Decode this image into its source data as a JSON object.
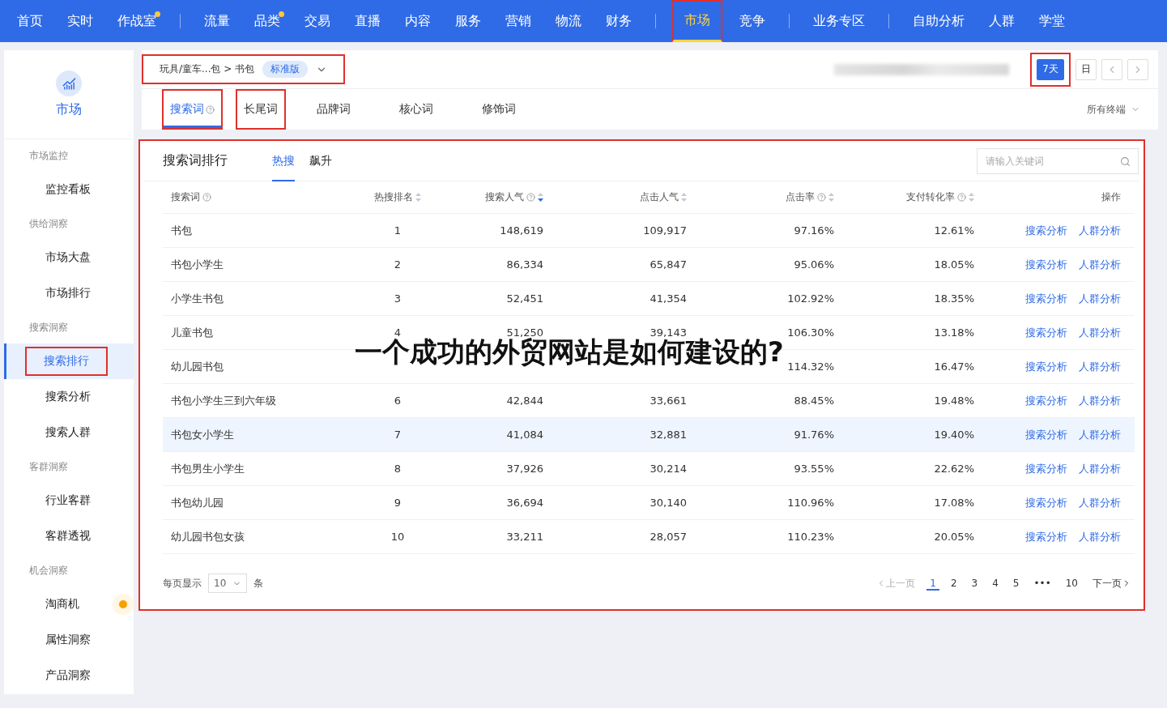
{
  "nav": {
    "groups": [
      [
        {
          "label": "首页",
          "dot": false,
          "selected": false,
          "annotated": false
        },
        {
          "label": "实时",
          "dot": false,
          "selected": false,
          "annotated": false
        },
        {
          "label": "作战室",
          "dot": true,
          "selected": false,
          "annotated": false
        }
      ],
      [
        {
          "label": "流量",
          "dot": false,
          "selected": false,
          "annotated": false
        },
        {
          "label": "品类",
          "dot": true,
          "selected": false,
          "annotated": false
        },
        {
          "label": "交易",
          "dot": false,
          "selected": false,
          "annotated": false
        },
        {
          "label": "直播",
          "dot": false,
          "selected": false,
          "annotated": false
        },
        {
          "label": "内容",
          "dot": false,
          "selected": false,
          "annotated": false
        },
        {
          "label": "服务",
          "dot": false,
          "selected": false,
          "annotated": false
        },
        {
          "label": "营销",
          "dot": false,
          "selected": false,
          "annotated": false
        },
        {
          "label": "物流",
          "dot": false,
          "selected": false,
          "annotated": false
        },
        {
          "label": "财务",
          "dot": false,
          "selected": false,
          "annotated": false
        }
      ],
      [
        {
          "label": "市场",
          "dot": false,
          "selected": true,
          "annotated": true
        },
        {
          "label": "竞争",
          "dot": false,
          "selected": false,
          "annotated": false
        }
      ],
      [
        {
          "label": "业务专区",
          "dot": false,
          "selected": false,
          "annotated": false
        }
      ],
      [
        {
          "label": "自助分析",
          "dot": false,
          "selected": false,
          "annotated": false
        },
        {
          "label": "人群",
          "dot": false,
          "selected": false,
          "annotated": false
        },
        {
          "label": "学堂",
          "dot": false,
          "selected": false,
          "annotated": false
        }
      ]
    ]
  },
  "sidebar": {
    "title": "市场",
    "sections": [
      {
        "heading": "市场监控",
        "items": [
          {
            "label": "监控看板",
            "selected": false,
            "annotated": false,
            "dot": false
          }
        ]
      },
      {
        "heading": "供给洞察",
        "items": [
          {
            "label": "市场大盘",
            "selected": false,
            "annotated": false,
            "dot": false
          },
          {
            "label": "市场排行",
            "selected": false,
            "annotated": false,
            "dot": false
          }
        ]
      },
      {
        "heading": "搜索洞察",
        "items": [
          {
            "label": "搜索排行",
            "selected": true,
            "annotated": true,
            "dot": false
          },
          {
            "label": "搜索分析",
            "selected": false,
            "annotated": false,
            "dot": false
          },
          {
            "label": "搜索人群",
            "selected": false,
            "annotated": false,
            "dot": false
          }
        ]
      },
      {
        "heading": "客群洞察",
        "items": [
          {
            "label": "行业客群",
            "selected": false,
            "annotated": false,
            "dot": false
          },
          {
            "label": "客群透视",
            "selected": false,
            "annotated": false,
            "dot": false
          }
        ]
      },
      {
        "heading": "机会洞察",
        "items": [
          {
            "label": "淘商机",
            "selected": false,
            "annotated": false,
            "dot": true
          },
          {
            "label": "属性洞察",
            "selected": false,
            "annotated": false,
            "dot": false
          },
          {
            "label": "产品洞察",
            "selected": false,
            "annotated": false,
            "dot": false
          }
        ]
      }
    ]
  },
  "filter": {
    "breadcrumb": "玩具/童车...包 > 书包",
    "badge": "标准版",
    "annotated": true,
    "periods": [
      {
        "label": "7天",
        "selected": true,
        "annotated": true
      },
      {
        "label": "日",
        "selected": false,
        "annotated": false
      }
    ],
    "tabs": [
      {
        "label": "搜索词",
        "help": true,
        "selected": true,
        "annotated": true
      },
      {
        "label": "长尾词",
        "help": false,
        "selected": false,
        "annotated": true
      },
      {
        "label": "品牌词",
        "help": false,
        "selected": false,
        "annotated": false
      },
      {
        "label": "核心词",
        "help": false,
        "selected": false,
        "annotated": false
      },
      {
        "label": "修饰词",
        "help": false,
        "selected": false,
        "annotated": false
      }
    ],
    "terminal": "所有终端"
  },
  "ranking": {
    "title": "搜索词排行",
    "annotated": true,
    "tabs": [
      {
        "label": "热搜",
        "selected": true
      },
      {
        "label": "飙升",
        "selected": false
      }
    ],
    "search": {
      "placeholder": "请输入关键词"
    },
    "columns": [
      {
        "label": "搜索词",
        "help": true,
        "sortable": false
      },
      {
        "label": "热搜排名",
        "help": false,
        "sortable": true,
        "sorted": false
      },
      {
        "label": "搜索人气",
        "help": true,
        "sortable": true,
        "sorted": true
      },
      {
        "label": "点击人气",
        "help": false,
        "sortable": true,
        "sorted": false
      },
      {
        "label": "点击率",
        "help": true,
        "sortable": true,
        "sorted": false
      },
      {
        "label": "支付转化率",
        "help": true,
        "sortable": true,
        "sorted": false
      },
      {
        "label": "操作",
        "help": false,
        "sortable": false
      }
    ],
    "rows": [
      {
        "keyword": "书包",
        "rank": "1",
        "search": "148,619",
        "clicks": "109,917",
        "click_rate": "97.16%",
        "conversion": "12.61%",
        "actions": [
          "搜索分析",
          "人群分析"
        ],
        "highlighted": false
      },
      {
        "keyword": "书包小学生",
        "rank": "2",
        "search": "86,334",
        "clicks": "65,847",
        "click_rate": "95.06%",
        "conversion": "18.05%",
        "actions": [
          "搜索分析",
          "人群分析"
        ],
        "highlighted": false
      },
      {
        "keyword": "小学生书包",
        "rank": "3",
        "search": "52,451",
        "clicks": "41,354",
        "click_rate": "102.92%",
        "conversion": "18.35%",
        "actions": [
          "搜索分析",
          "人群分析"
        ],
        "highlighted": false
      },
      {
        "keyword": "儿童书包",
        "rank": "4",
        "search": "51,250",
        "clicks": "39,143",
        "click_rate": "106.30%",
        "conversion": "13.18%",
        "actions": [
          "搜索分析",
          "人群分析"
        ],
        "highlighted": false
      },
      {
        "keyword": "幼儿园书包",
        "click_rate": "114.32%",
        "conversion": "16.47%",
        "actions": [
          "搜索分析",
          "人群分析"
        ],
        "highlighted": false
      },
      {
        "keyword": "书包小学生三到六年级",
        "rank": "6",
        "search": "42,844",
        "clicks": "33,661",
        "click_rate": "88.45%",
        "conversion": "19.48%",
        "actions": [
          "搜索分析",
          "人群分析"
        ],
        "highlighted": false
      },
      {
        "keyword": "书包女小学生",
        "rank": "7",
        "search": "41,084",
        "clicks": "32,881",
        "click_rate": "91.76%",
        "conversion": "19.40%",
        "actions": [
          "搜索分析",
          "人群分析"
        ],
        "highlighted": true
      },
      {
        "keyword": "书包男生小学生",
        "rank": "8",
        "search": "37,926",
        "clicks": "30,214",
        "click_rate": "93.55%",
        "conversion": "22.62%",
        "actions": [
          "搜索分析",
          "人群分析"
        ],
        "highlighted": false
      },
      {
        "keyword": "书包幼儿园",
        "rank": "9",
        "search": "36,694",
        "clicks": "30,140",
        "click_rate": "110.96%",
        "conversion": "17.08%",
        "actions": [
          "搜索分析",
          "人群分析"
        ],
        "highlighted": false
      },
      {
        "keyword": "幼儿园书包女孩",
        "rank": "10",
        "search": "33,211",
        "clicks": "28,057",
        "click_rate": "110.23%",
        "conversion": "20.05%",
        "actions": [
          "搜索分析",
          "人群分析"
        ],
        "highlighted": false
      }
    ],
    "page_size": {
      "prefix": "每页显示",
      "value": "10",
      "suffix": "条"
    },
    "pagination": {
      "prev": "上一页",
      "pages": [
        {
          "label": "1",
          "selected": true
        },
        {
          "label": "2",
          "selected": false
        },
        {
          "label": "3",
          "selected": false
        },
        {
          "label": "4",
          "selected": false
        },
        {
          "label": "5",
          "selected": false
        },
        {
          "label": "•••",
          "selected": false
        },
        {
          "label": "10",
          "selected": false
        }
      ],
      "next": "下一页"
    }
  },
  "overlay_banner": {
    "text": "一个成功的外贸网站是如何建设的?"
  }
}
